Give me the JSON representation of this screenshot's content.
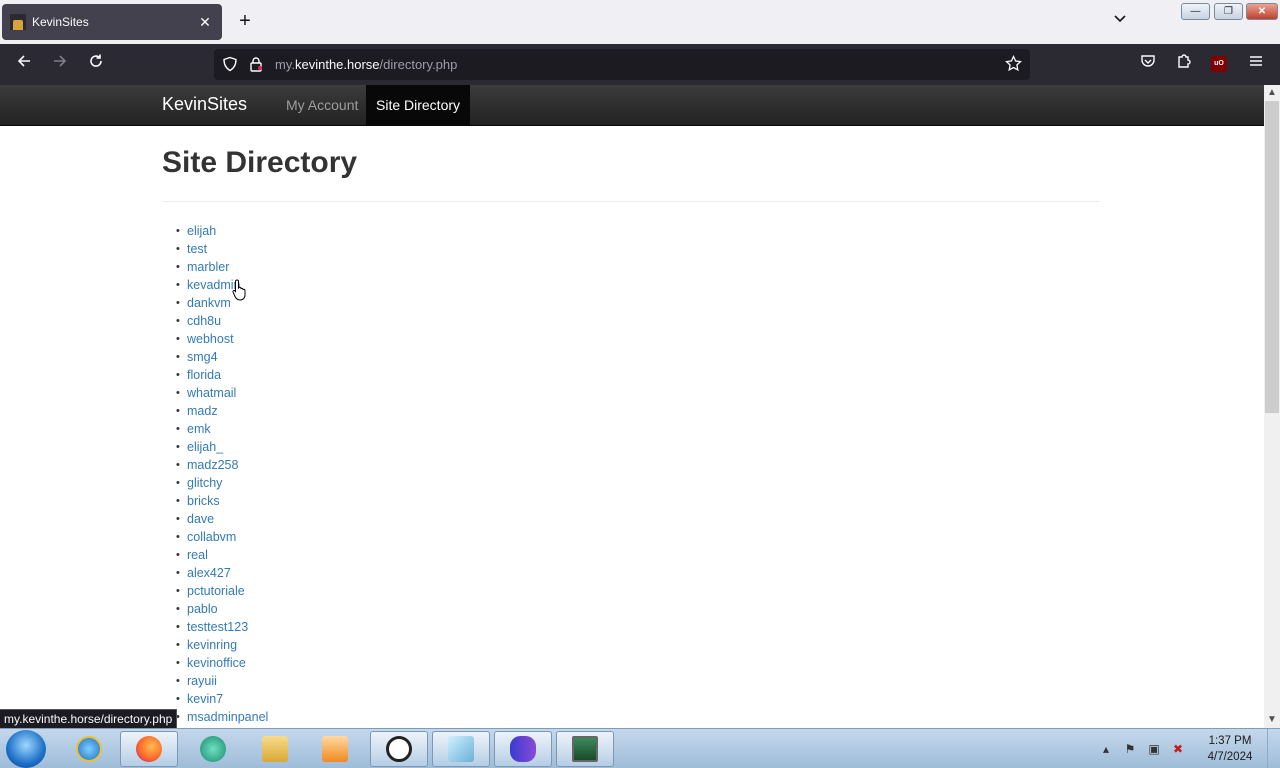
{
  "browser": {
    "tab_title": "KevinSites",
    "url_prefix": "my.",
    "url_domain": "kevinthe.horse",
    "url_path": "/directory.php",
    "status_url": "my.kevinthe.horse/directory.php",
    "ublock_label": "uO"
  },
  "site": {
    "brand": "KevinSites",
    "nav_account": "My Account",
    "nav_directory": "Site Directory",
    "page_title": "Site Directory",
    "sites": [
      "elijah",
      "test",
      "marbler",
      "kevadmin",
      "dankvm",
      "cdh8u",
      "webhost",
      "smg4",
      "florida",
      "whatmail",
      "madz",
      "emk",
      "elijah_",
      "madz258",
      "glitchy",
      "bricks",
      "dave",
      "collabvm",
      "real",
      "alex427",
      "pctutoriale",
      "pablo",
      "testtest123",
      "kevinring",
      "kevinoffice",
      "rayuii",
      "kevin7",
      "msadminpanel"
    ]
  },
  "taskbar": {
    "time": "1:37 PM",
    "date": "4/7/2024"
  },
  "icons": {
    "back": "arrow-left-icon",
    "forward": "arrow-right-icon",
    "reload": "reload-icon",
    "shield": "tracking-shield-icon",
    "lock": "lock-icon",
    "bookmark": "star-icon",
    "pocket": "pocket-icon",
    "extensions": "puzzle-icon",
    "menu": "hamburger-menu-icon"
  }
}
